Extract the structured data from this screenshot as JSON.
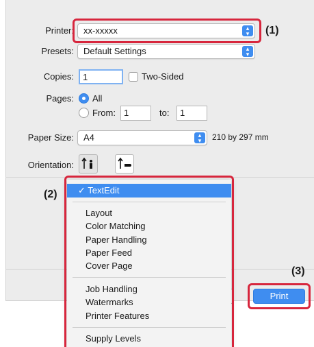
{
  "printer": {
    "label": "Printer:",
    "value": "xx-xxxxx"
  },
  "presets": {
    "label": "Presets:",
    "value": "Default Settings"
  },
  "copies": {
    "label": "Copies:",
    "value": "1",
    "two_sided_label": "Two-Sided",
    "two_sided_checked": false
  },
  "pages": {
    "label": "Pages:",
    "all_label": "All",
    "from_label": "From:",
    "from_value": "1",
    "to_label": "to:",
    "to_value": "1",
    "selected": "All"
  },
  "paper_size": {
    "label": "Paper Size:",
    "value": "A4",
    "dimensions": "210 by 297 mm"
  },
  "orientation": {
    "label": "Orientation:",
    "selected": "portrait"
  },
  "menu": {
    "selected": "TextEdit",
    "group1": [
      "Layout",
      "Color Matching",
      "Paper Handling",
      "Paper Feed",
      "Cover Page"
    ],
    "group2": [
      "Job Handling",
      "Watermarks",
      "Printer Features"
    ],
    "group3": [
      "Supply Levels"
    ]
  },
  "buttons": {
    "print": "Print",
    "cancel_partial": "l"
  },
  "callouts": {
    "c1": "(1)",
    "c2": "(2)",
    "c3": "(3)"
  },
  "colors": {
    "accent": "#3f8df0",
    "highlight_red": "#d7263d",
    "dialog_bg": "#ececec"
  }
}
